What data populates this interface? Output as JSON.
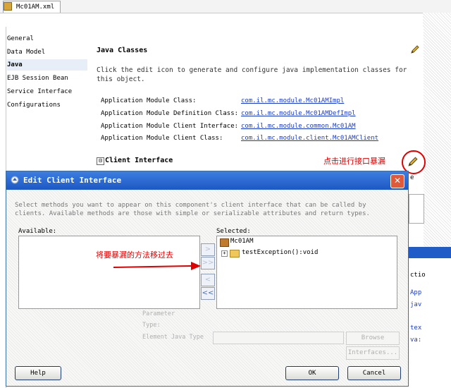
{
  "tab": {
    "filename": "Mc01AM.xml"
  },
  "nav": {
    "items": [
      "General",
      "Data Model",
      "Java",
      "EJB Session Bean",
      "Service Interface",
      "Configurations"
    ],
    "selected": "Java"
  },
  "main": {
    "heading": "Java Classes",
    "description": "Click the edit icon to generate and configure java implementation classes for this object.",
    "rows": [
      {
        "label": "Application Module Class:",
        "value": "com.il.mc.module.Mc01AMImpl"
      },
      {
        "label": "Application Module Definition Class:",
        "value": "com.il.mc.module.Mc01AMDefImpl"
      },
      {
        "label": "Application Module Client Interface:",
        "value": "com.il.mc.module.common.Mc01AM"
      },
      {
        "label": "Application Module Client Class:",
        "value": "com.il.mc.module.client.Mc01AMClient"
      }
    ],
    "client_interface_toggle": "⊟",
    "client_interface_heading": "Client Interface",
    "annotation": "点击进行接口暴漏",
    "annotation_color": "#e00000"
  },
  "peek": {
    "e": "e",
    "ctio": "ctio",
    "app": "App",
    "jav": "jav",
    "tex": "tex",
    "va": "va:"
  },
  "dialog": {
    "title": "Edit Client Interface",
    "close_glyph": "✕",
    "description": "Select methods you want to appear on this component's client interface that can be called by clients. Available methods are those with simple or serializable attributes and return types.",
    "available_label": "Available:",
    "selected_label": "Selected:",
    "move_buttons": [
      ">",
      ">>",
      "<",
      "<<"
    ],
    "tree": {
      "root": "Mc01AM",
      "expander": "+",
      "child": "testException():void"
    },
    "annotation": "将要暴漏的方法移过去",
    "parameter_label": "Parameter",
    "type_label": "Type:",
    "element_type_label": "Element Java Type",
    "browse_label": "Browse",
    "interfaces_label": "Interfaces...",
    "help_label": "Help",
    "ok_label": "OK",
    "cancel_label": "Cancel",
    "titlebar_color": "#1d58c3"
  }
}
